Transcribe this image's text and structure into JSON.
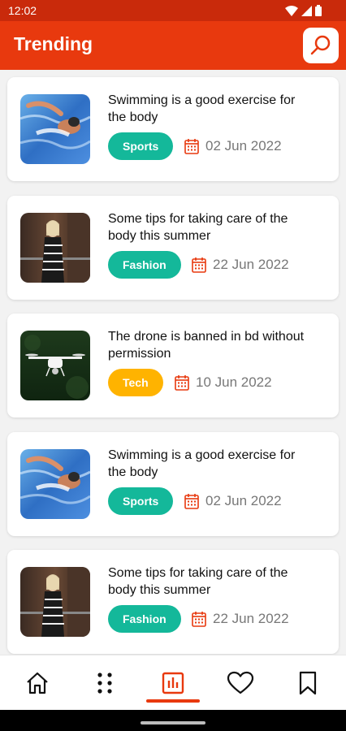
{
  "status_bar": {
    "time": "12:02",
    "icons": [
      "wifi-icon",
      "signal-icon",
      "battery-icon"
    ]
  },
  "app_bar": {
    "title": "Trending",
    "search_icon": "search-icon"
  },
  "colors": {
    "primary": "#e8390e",
    "badge_green": "#14b89a",
    "badge_amber": "#ffb300"
  },
  "articles": [
    {
      "title": "Swimming is a good exercise for the body",
      "category": "Sports",
      "date": "02 Jun 2022",
      "image": "swimmer"
    },
    {
      "title": "Some tips for taking care of the body this summer",
      "category": "Fashion",
      "date": "22 Jun 2022",
      "image": "woman"
    },
    {
      "title": "The drone is banned in bd without permission",
      "category": "Tech",
      "date": "10 Jun 2022",
      "image": "drone"
    },
    {
      "title": "Swimming is a good exercise for the body",
      "category": "Sports",
      "date": "02 Jun 2022",
      "image": "swimmer"
    },
    {
      "title": "Some tips for taking care of the body this summer",
      "category": "Fashion",
      "date": "22 Jun 2022",
      "image": "woman"
    }
  ],
  "bottom_nav": {
    "items": [
      "home-icon",
      "apps-icon",
      "trending-chart-icon",
      "heart-icon",
      "bookmark-icon"
    ],
    "active": "trending-chart-icon"
  }
}
